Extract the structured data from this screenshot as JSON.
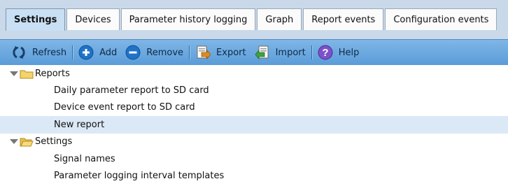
{
  "tabs": [
    {
      "label": "Settings",
      "active": true
    },
    {
      "label": "Devices",
      "active": false
    },
    {
      "label": "Parameter history logging",
      "active": false
    },
    {
      "label": "Graph",
      "active": false
    },
    {
      "label": "Report events",
      "active": false
    },
    {
      "label": "Configuration events",
      "active": false
    }
  ],
  "toolbar": {
    "refresh": {
      "label": "Refresh",
      "icon": "refresh-icon"
    },
    "add": {
      "label": "Add",
      "icon": "add-icon"
    },
    "remove": {
      "label": "Remove",
      "icon": "remove-icon"
    },
    "export": {
      "label": "Export",
      "icon": "export-icon"
    },
    "import": {
      "label": "Import",
      "icon": "import-icon"
    },
    "help": {
      "label": "Help",
      "icon": "help-icon"
    }
  },
  "tree": {
    "reports": {
      "label": "Reports",
      "icon": "folder-icon",
      "children": [
        {
          "label": "Daily parameter report to SD card"
        },
        {
          "label": "Device event report to SD card"
        },
        {
          "label": "New report",
          "selected": true
        }
      ]
    },
    "settings": {
      "label": "Settings",
      "icon": "folder-open-icon",
      "children": [
        {
          "label": "Signal names"
        },
        {
          "label": "Parameter logging interval templates"
        }
      ]
    }
  },
  "colors": {
    "tab_strip": "#c9d9ea",
    "active_tab": "#c8dff4",
    "toolbar": "#6aa8de",
    "selected_row": "#dbe8f6",
    "folder": "#f3d36b"
  }
}
